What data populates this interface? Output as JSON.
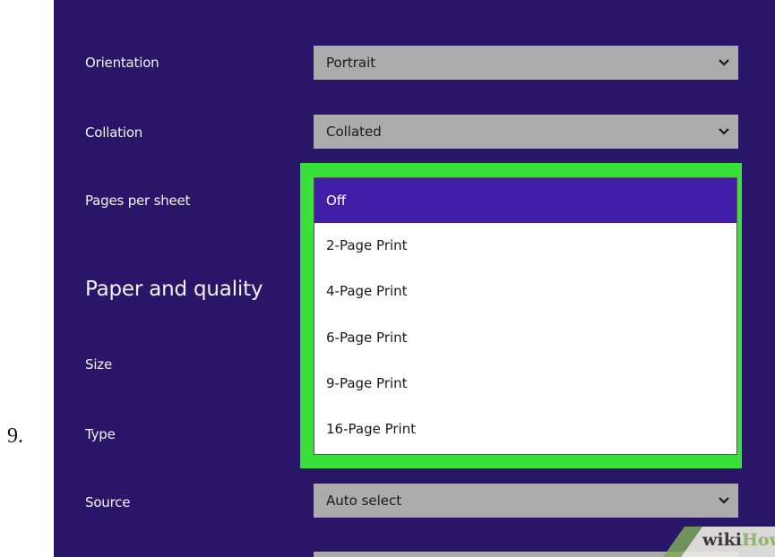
{
  "step_number": "9.",
  "settings": {
    "orientation": {
      "label": "Orientation",
      "value": "Portrait"
    },
    "collation": {
      "label": "Collation",
      "value": "Collated"
    },
    "pages_per_sheet": {
      "label": "Pages per sheet"
    },
    "section_heading": "Paper and quality",
    "size": {
      "label": "Size"
    },
    "type": {
      "label": "Type"
    },
    "source": {
      "label": "Source",
      "value": "Auto select"
    }
  },
  "pages_per_sheet_dropdown": {
    "options": [
      "Off",
      "2-Page Print",
      "4-Page Print",
      "6-Page Print",
      "9-Page Print",
      "16-Page Print"
    ],
    "selected": "Off"
  },
  "icons": {
    "dropdown_arrow": "chevron-down-icon"
  },
  "colors": {
    "panel_background": "#2a1668",
    "select_background": "#ababab",
    "selected_option": "#3f1fa8",
    "highlight_border": "#3ae03a"
  },
  "watermark": {
    "part1": "wiki",
    "part2": "How"
  }
}
